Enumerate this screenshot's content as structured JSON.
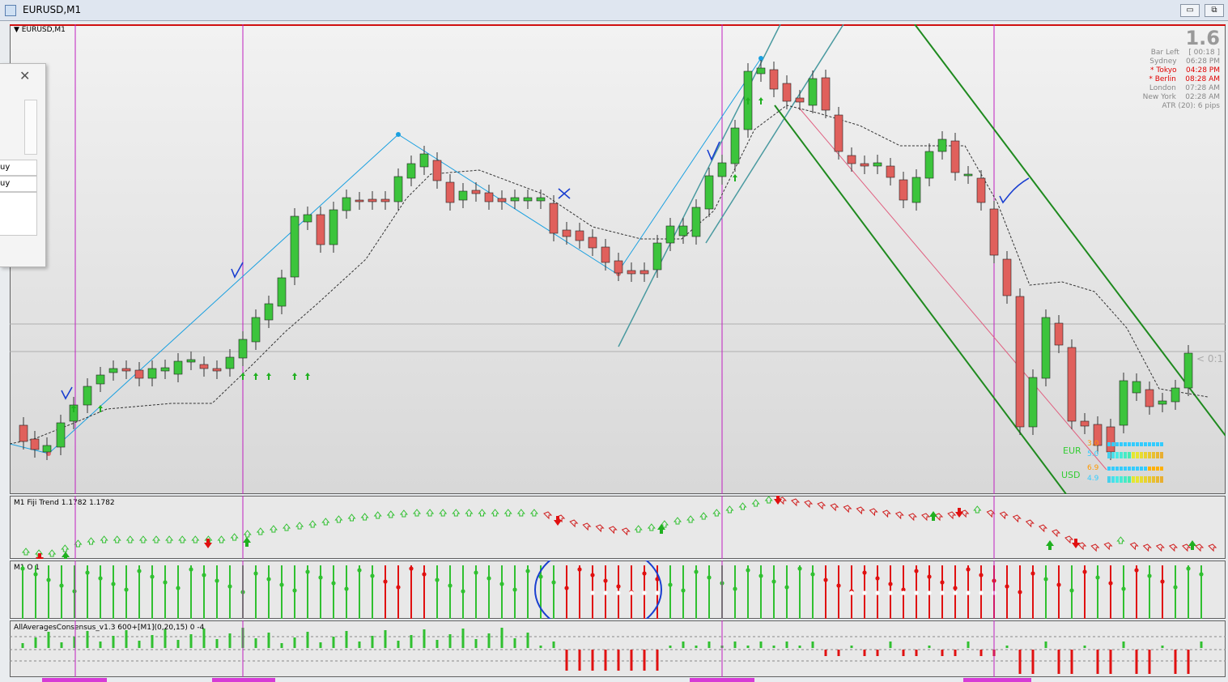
{
  "window": {
    "title": "EURUSD,M1",
    "min_label": "▭",
    "max_label": "⧉"
  },
  "chart_label": "EURUSD,M1",
  "dialog": {
    "rows": [
      "uy",
      "uy"
    ]
  },
  "info": {
    "big": "1.6",
    "rows": [
      {
        "name": "Bar Left",
        "value": "[ 00:18 ]",
        "red": false
      },
      {
        "name": "Sydney",
        "value": "06:28 PM",
        "red": false
      },
      {
        "name": "* Tokyo",
        "value": "04:28 PM",
        "red": true
      },
      {
        "name": "* Berlin",
        "value": "08:28 AM",
        "red": true
      },
      {
        "name": "London",
        "value": "07:28 AM",
        "red": false
      },
      {
        "name": "New York",
        "value": "02:28 AM",
        "red": false
      }
    ],
    "atr": "ATR (20): 6 pips"
  },
  "price_tag": "< 0:1",
  "currency": {
    "eur_label": "EUR",
    "usd_label": "USD",
    "eur_vals": [
      "3.0",
      "5.0"
    ],
    "usd_vals": [
      "6.9",
      "4.9"
    ]
  },
  "fiji_label": "M1 Fiji Trend 1.1782 1.1782",
  "osc_label": "M1 O 1",
  "avg_label": "AllAveragesConsensus_v1.3 600+[M1](0,20,15) 0 -4",
  "colors": {
    "bull": "#3cc43c",
    "bear": "#e0605c",
    "accent": "#1aa0e0",
    "channel": "#1f8a1f",
    "vline": "#c020c0"
  }
}
